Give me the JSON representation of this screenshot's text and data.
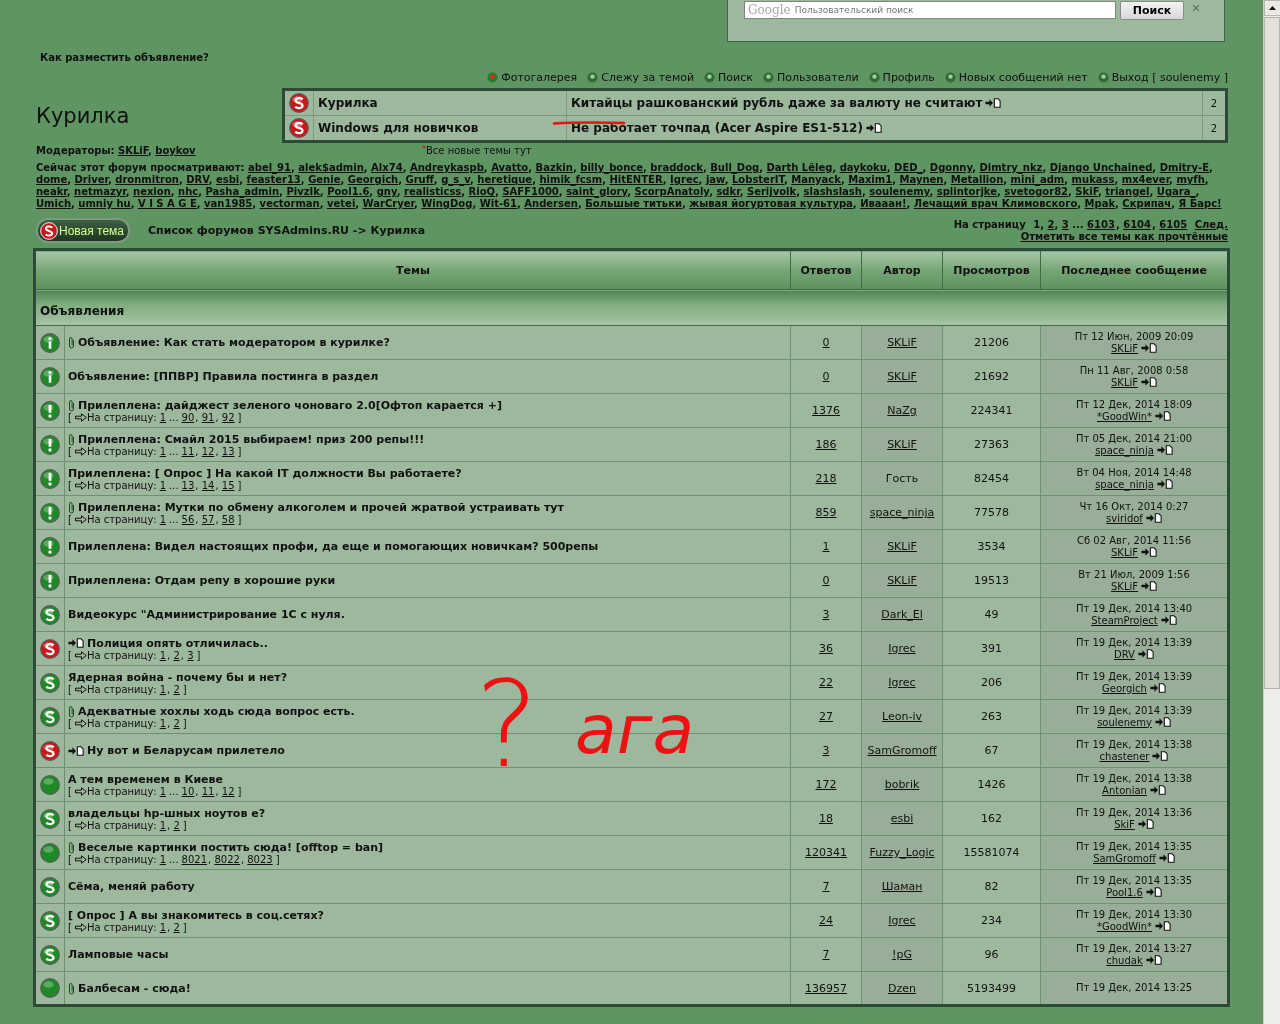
{
  "search": {
    "brand": "Google",
    "placeholder": "Пользовательский поиск",
    "button": "Поиск",
    "close": "×"
  },
  "header_link": "Как разместить объявление?",
  "nav": [
    "Фотогалерея",
    "Слежу за темой",
    "Поиск",
    "Пользователи",
    "Профиль",
    "Новых сообщений нет",
    "Выход [ soulenemy ]"
  ],
  "forum_title": "Курилка",
  "new_topics": {
    "rows": [
      {
        "forum": "Курилка",
        "topic": "Китайцы рашкованский рубль даже за валюту не считают",
        "count": "2"
      },
      {
        "forum": "Windows для новичков",
        "topic": "Не работает точпад (Acer Aspire ES1-512)",
        "count": "2"
      }
    ],
    "note_mark": "*",
    "note": "Все новые темы тут"
  },
  "separator": ",",
  "moderators": {
    "label": "Модераторы:",
    "names": [
      "SKLiF",
      "boykov"
    ]
  },
  "viewers": {
    "label": "Сейчас этот форум просматривают:",
    "names": [
      "abel_91",
      "alek$admin",
      "Alx74",
      "Andreykaspb",
      "Avatto",
      "Bazkin",
      "billy_bonce",
      "braddock",
      "Bull_Dog",
      "Darth Lёleg",
      "daykoku",
      "DED_",
      "Dgonny",
      "Dimtry_nkz",
      "Django Unchained",
      "Dmitry-E",
      "dome",
      "Driver",
      "dronmitron",
      "DRV",
      "esbi",
      "feaster13",
      "Genie",
      "Georgich",
      "Gruff",
      "g_s_v",
      "heretique",
      "himik_fcsm",
      "HitENTER",
      "Igrec",
      "jaw",
      "LobsterIT",
      "Manyack",
      "Maxim1",
      "Maynen",
      "Metallion",
      "mini_adm",
      "mukass",
      "mx4ever",
      "myfh",
      "neakr",
      "netmazyr",
      "nexion",
      "nhc",
      "Pasha_admin",
      "PivzIk",
      "Pool1.6",
      "gny",
      "realisticss",
      "RioQ",
      "SAFF1000",
      "saint_glory",
      "ScorpAnatoly",
      "sdkr",
      "Serijvolk",
      "slashslash",
      "soulenemy",
      "splintorjke",
      "svetogor82",
      "SkiF",
      "triangel",
      "Ugara_",
      "Umich",
      "umniy hu",
      "V I S A G E",
      "van1985",
      "vectorman",
      "vetei",
      "WarCryer",
      "WingDog",
      "Wit-61",
      "Andersen",
      "Большые титьки",
      "жывая йогуртовая культура",
      "Ивааан!",
      "Лечащий врач Климовского",
      "Mpak",
      "Скрипач",
      "Я Барс!"
    ]
  },
  "new_topic_button": "Новая тема",
  "breadcrumb": "Список форумов SYSAdmins.RU -> Курилка",
  "pagination": {
    "label": "На страницу",
    "current": "1",
    "head": [
      "2",
      "3"
    ],
    "gap": "...",
    "tail": [
      "6103",
      "6104",
      "6105"
    ],
    "next": "След."
  },
  "mark_read": "Отметить все темы как прочтённые",
  "pager": {
    "open": "[",
    "close": "]"
  },
  "table": {
    "columns": [
      "Темы",
      "Ответов",
      "Автор",
      "Просмотров",
      "Последнее сообщение"
    ],
    "section": "Объявления",
    "rows": [
      {
        "kind": "announcement",
        "attachment": true,
        "new_post": false,
        "title": "Объявление: Как стать модератором в курилке?",
        "replies": "0",
        "author": "SKLiF",
        "author_link": true,
        "views": "21206",
        "last_date": "Пт 12 Июн, 2009 20:09",
        "last_user": "SKLiF"
      },
      {
        "kind": "announcement",
        "attachment": false,
        "new_post": false,
        "title": "Объявление: [ППВР] Правила постинга в раздел",
        "replies": "0",
        "author": "SKLiF",
        "author_link": true,
        "views": "21692",
        "last_date": "Пн 11 Авг, 2008 0:58",
        "last_user": "SKLiF"
      },
      {
        "kind": "sticky",
        "attachment": true,
        "new_post": false,
        "title": "Прилеплена: дайджест зеленого чоноваго 2.0[Офтоп карается +]",
        "pages": {
          "label": "На страницу:",
          "head": [
            "1"
          ],
          "gap": "...",
          "tail": [
            "90",
            "91",
            "92"
          ]
        },
        "replies": "1376",
        "author": "NaZg",
        "author_link": true,
        "views": "224341",
        "last_date": "Пт 12 Дек, 2014 18:09",
        "last_user": "*GoodWin*"
      },
      {
        "kind": "sticky",
        "attachment": true,
        "new_post": false,
        "title": "Прилеплена: Смайл 2015 выбираем! приз 200 репы!!!",
        "pages": {
          "label": "На страницу:",
          "head": [
            "1"
          ],
          "gap": "...",
          "tail": [
            "11",
            "12",
            "13"
          ]
        },
        "replies": "186",
        "author": "SKLiF",
        "author_link": true,
        "views": "27363",
        "last_date": "Пт 05 Дек, 2014 21:00",
        "last_user": "space_ninja"
      },
      {
        "kind": "sticky",
        "attachment": false,
        "new_post": false,
        "title": "Прилеплена: [ Опрос ] На какой IT должности Вы работаете?",
        "pages": {
          "label": "На страницу:",
          "head": [
            "1"
          ],
          "gap": "...",
          "tail": [
            "13",
            "14",
            "15"
          ]
        },
        "replies": "218",
        "author": "Гость",
        "author_link": false,
        "views": "82454",
        "last_date": "Вт 04 Ноя, 2014 14:48",
        "last_user": "space_ninja"
      },
      {
        "kind": "sticky",
        "attachment": true,
        "new_post": false,
        "title": "Прилеплена: Мутки по обмену алкоголем и прочей жратвой устраивать тут",
        "pages": {
          "label": "На страницу:",
          "head": [
            "1"
          ],
          "gap": "...",
          "tail": [
            "56",
            "57",
            "58"
          ]
        },
        "replies": "859",
        "author": "space_ninja",
        "author_link": true,
        "views": "77578",
        "last_date": "Чт 16 Окт, 2014 0:27",
        "last_user": "sviridof"
      },
      {
        "kind": "sticky",
        "attachment": false,
        "new_post": false,
        "title": "Прилеплена: Видел настоящих профи, да еще и помогающих новичкам? 500репы",
        "replies": "1",
        "author": "SKLiF",
        "author_link": true,
        "views": "3534",
        "last_date": "Сб 02 Авг, 2014 11:56",
        "last_user": "SKLiF"
      },
      {
        "kind": "sticky",
        "attachment": false,
        "new_post": false,
        "title": "Прилеплена: Отдам репу в хорошие руки",
        "replies": "0",
        "author": "SKLiF",
        "author_link": true,
        "views": "19513",
        "last_date": "Вт 21 Июл, 2009 1:56",
        "last_user": "SKLiF"
      },
      {
        "kind": "read",
        "attachment": false,
        "new_post": false,
        "title": "Видеокурс \"Администрирование 1С с нуля.",
        "replies": "3",
        "author": "Dark_El",
        "author_link": true,
        "views": "49",
        "last_date": "Пт 19 Дек, 2014 13:40",
        "last_user": "SteamProject"
      },
      {
        "kind": "unread",
        "attachment": false,
        "new_post": true,
        "title": "Полиция опять отличилась..",
        "pages": {
          "label": "На страницу:",
          "head": [
            "1",
            "2",
            "3"
          ]
        },
        "replies": "36",
        "author": "Igrec",
        "author_link": true,
        "views": "391",
        "last_date": "Пт 19 Дек, 2014 13:39",
        "last_user": "DRV"
      },
      {
        "kind": "read",
        "attachment": false,
        "new_post": false,
        "title": "Ядерная война - почему бы и нет?",
        "pages": {
          "label": "На страницу:",
          "head": [
            "1",
            "2"
          ]
        },
        "replies": "22",
        "author": "Igrec",
        "author_link": true,
        "views": "206",
        "last_date": "Пт 19 Дек, 2014 13:39",
        "last_user": "Georgich"
      },
      {
        "kind": "read",
        "attachment": true,
        "new_post": false,
        "title": "Адекватные хохлы ходь сюда вопрос есть.",
        "pages": {
          "label": "На страницу:",
          "head": [
            "1",
            "2"
          ]
        },
        "replies": "27",
        "author": "Leon-iv",
        "author_link": true,
        "views": "263",
        "last_date": "Пт 19 Дек, 2014 13:39",
        "last_user": "soulenemy"
      },
      {
        "kind": "unread",
        "attachment": false,
        "new_post": true,
        "title": "Ну вот и Беларусам прилетело",
        "replies": "3",
        "author": "SamGromoff",
        "author_link": true,
        "views": "67",
        "last_date": "Пт 19 Дек, 2014 13:38",
        "last_user": "chastener"
      },
      {
        "kind": "hot",
        "attachment": false,
        "new_post": false,
        "title": "А тем временем в Киеве",
        "pages": {
          "label": "На страницу:",
          "head": [
            "1"
          ],
          "gap": "...",
          "tail": [
            "10",
            "11",
            "12"
          ]
        },
        "replies": "172",
        "author": "bobrik",
        "author_link": true,
        "views": "1426",
        "last_date": "Пт 19 Дек, 2014 13:38",
        "last_user": "Antonian"
      },
      {
        "kind": "read",
        "attachment": false,
        "new_post": false,
        "title": "владельцы hp-шных ноутов е?",
        "pages": {
          "label": "На страницу:",
          "head": [
            "1",
            "2"
          ]
        },
        "replies": "18",
        "author": "esbi",
        "author_link": true,
        "views": "162",
        "last_date": "Пт 19 Дек, 2014 13:36",
        "last_user": "SkiF"
      },
      {
        "kind": "hot",
        "attachment": true,
        "new_post": false,
        "title": "Веселые картинки постить сюда! [offtop = ban]",
        "pages": {
          "label": "На страницу:",
          "head": [
            "1"
          ],
          "gap": "...",
          "tail": [
            "8021",
            "8022",
            "8023"
          ]
        },
        "replies": "120341",
        "author": "Fuzzy_Logic",
        "author_link": true,
        "views": "15581074",
        "last_date": "Пт 19 Дек, 2014 13:35",
        "last_user": "SamGromoff"
      },
      {
        "kind": "read",
        "attachment": false,
        "new_post": false,
        "title": "Сёма, меняй работу",
        "replies": "7",
        "author": "Шаман",
        "author_link": true,
        "views": "82",
        "last_date": "Пт 19 Дек, 2014 13:35",
        "last_user": "Pool1.6"
      },
      {
        "kind": "read",
        "attachment": false,
        "new_post": false,
        "title": "[ Опрос ] А вы знакомитесь в соц.сетях?",
        "pages": {
          "label": "На страницу:",
          "head": [
            "1",
            "2"
          ]
        },
        "replies": "24",
        "author": "Igrec",
        "author_link": true,
        "views": "234",
        "last_date": "Пт 19 Дек, 2014 13:30",
        "last_user": "*GoodWin*"
      },
      {
        "kind": "read",
        "attachment": false,
        "new_post": false,
        "title": "Ламповые часы",
        "replies": "7",
        "author": "!pG",
        "author_link": true,
        "views": "96",
        "last_date": "Пт 19 Дек, 2014 13:27",
        "last_user": "chudak"
      },
      {
        "kind": "hot",
        "attachment": true,
        "new_post": false,
        "title": "Балбесам - сюда!",
        "replies": "136957",
        "author": "Dzen",
        "author_link": true,
        "views": "5193499",
        "last_date": "Пт 19 Дек, 2014 13:25"
      }
    ]
  },
  "annotations": [
    "?",
    "ага"
  ]
}
